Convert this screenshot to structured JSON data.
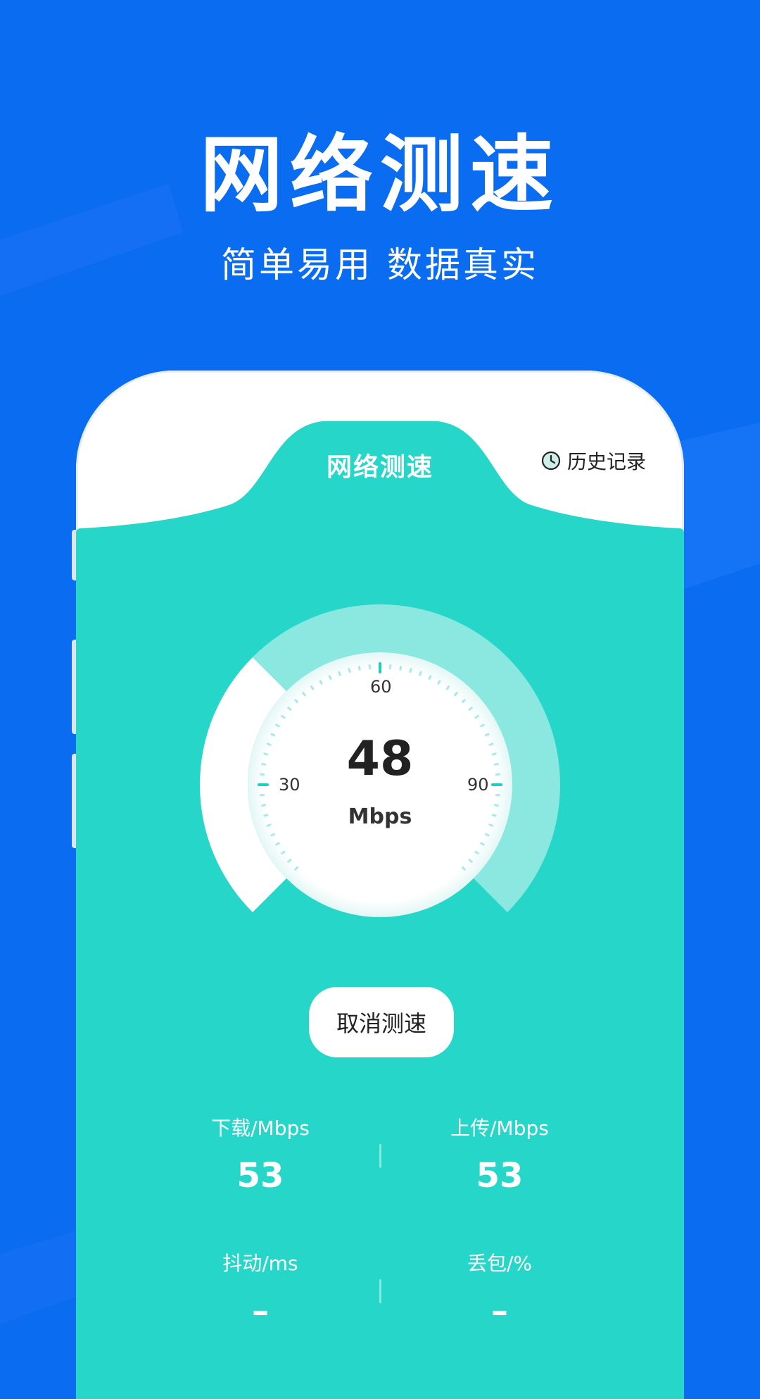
{
  "promo": {
    "title": "网络测速",
    "subtitle": "简单易用 数据真实"
  },
  "app": {
    "title": "网络测速",
    "history_label": "历史记录"
  },
  "gauge": {
    "speed": "48",
    "unit": "Mbps",
    "tick_left": "30",
    "tick_top": "60",
    "tick_right": "90"
  },
  "actions": {
    "cancel_label": "取消测速"
  },
  "stats": {
    "download": {
      "label": "下载/Mbps",
      "value": "53"
    },
    "upload": {
      "label": "上传/Mbps",
      "value": "53"
    },
    "jitter": {
      "label": "抖动/ms",
      "value": "–"
    },
    "packet_loss": {
      "label": "丢包/%",
      "value": "–"
    }
  },
  "colors": {
    "background": "#0a6cf0",
    "accent": "#26d6c8",
    "accent_light": "#8ae8e0",
    "white": "#ffffff"
  }
}
